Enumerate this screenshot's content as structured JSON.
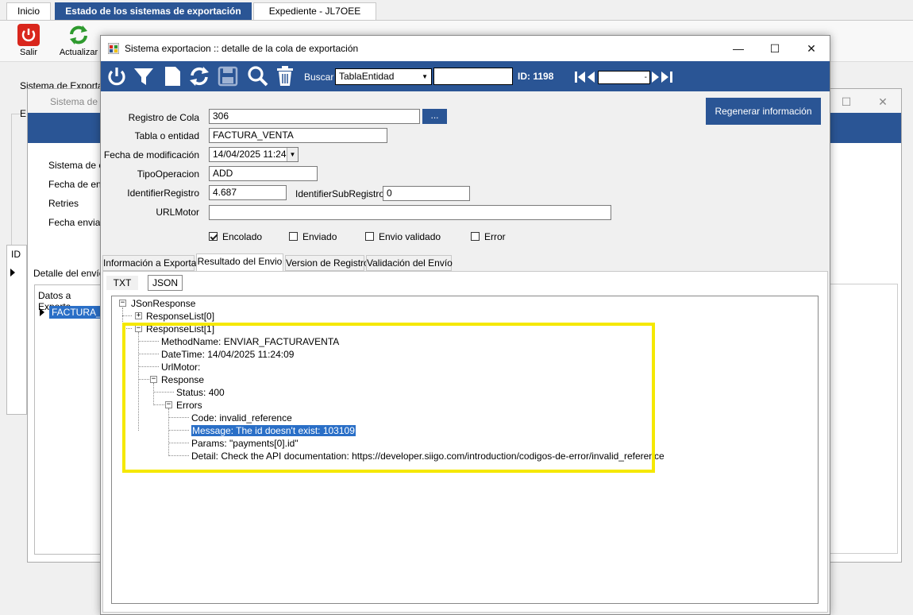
{
  "app": {
    "tabs": [
      "Inicio",
      "Estado de los sistemas de exportación",
      "Expediente  - JL7OEE"
    ],
    "toolbar": {
      "exit_label": "Salir",
      "refresh_label": "Actualizar"
    }
  },
  "background_window": {
    "title": "Sistema de e",
    "outer_label": "Sistema de Exportad",
    "group_label": "E",
    "fields": [
      "Sistema de e",
      "Fecha de enc",
      "Retries",
      "Fecha enviad"
    ],
    "grid_header": "ID",
    "detail_label": "Detalle del envío",
    "sub_header": "Datos a Exporta",
    "sub_row": "FACTURA_V"
  },
  "dialog": {
    "title": "Sistema exportacion :: detalle de la cola de exportación",
    "toolbar": {
      "search_label": "Buscar",
      "search_select": "TablaEntidad",
      "search_text": "",
      "id_label": "ID: 1198"
    },
    "regen_button": "Regenerar información",
    "form": {
      "registro_cola_label": "Registro de Cola",
      "registro_cola": "306",
      "browse_button": "...",
      "tabla_label": "Tabla o entidad",
      "tabla": "FACTURA_VENTA",
      "fecha_label": "Fecha de modificación",
      "fecha": "14/04/2025 11:24",
      "tipo_label": "TipoOperacion",
      "tipo": "ADD",
      "identifier_label": "IdentifierRegistro",
      "identifier": "4.687",
      "identifier_sub_label": "IdentifierSubRegistro",
      "identifier_sub": "0",
      "url_label": "URLMotor",
      "url": ""
    },
    "checks": [
      {
        "label": "Encolado",
        "checked": true
      },
      {
        "label": "Enviado",
        "checked": false
      },
      {
        "label": "Envio validado",
        "checked": false
      },
      {
        "label": "Error",
        "checked": false
      }
    ],
    "tabs": [
      "Información a Exportar",
      "Resultado del Envio",
      "Version de Registro",
      "Validación del Envío"
    ],
    "subtabs": [
      "TXT",
      "JSON"
    ],
    "tree": {
      "root": "JSonResponse",
      "list0": "ResponseList[0]",
      "list1": "ResponseList[1]",
      "method": "MethodName: ENVIAR_FACTURAVENTA",
      "datetime": "DateTime: 14/04/2025 11:24:09",
      "urlmotor": "UrlMotor:",
      "response": "Response",
      "status": "Status: 400",
      "errors": "Errors",
      "code": "Code: invalid_reference",
      "message": "Message: The id doesn't exist: 103109",
      "params": "Params:   \"payments[0].id\"",
      "detail": "Detail: Check the API documentation: https://developer.siigo.com/introduction/codigos-de-error/invalid_reference"
    }
  },
  "colors": {
    "accent": "#2a5595",
    "highlight_box": "#f5e800",
    "selection": "#2a6fc7"
  }
}
